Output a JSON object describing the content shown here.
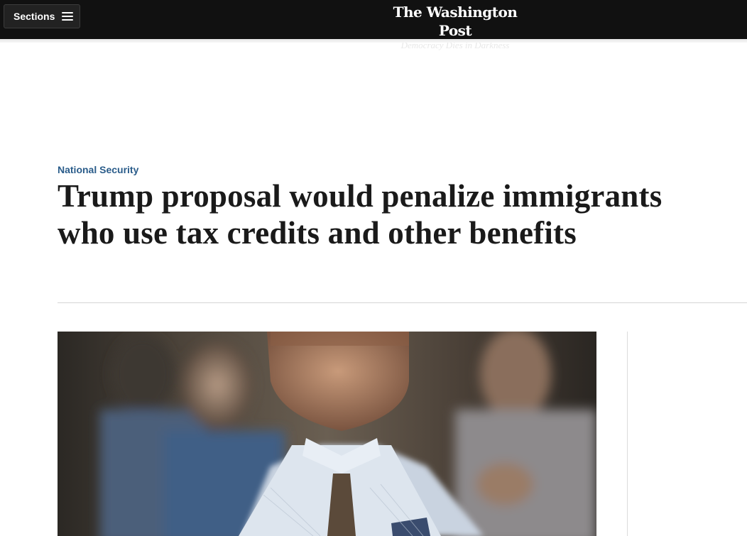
{
  "header": {
    "sections_label": "Sections",
    "menu_icon": "hamburger-menu-icon",
    "logo_text": "The Washington Post",
    "tagline": "Democracy Dies in Darkness"
  },
  "article": {
    "kicker": "National Security",
    "headline": "Trump proposal would penalize immigrants who use tax credits and other benefits",
    "photo_alt": "Man looking upward with hand on chest among a crowd"
  },
  "colors": {
    "topbar": "#111111",
    "kicker": "#2a5c8a",
    "headline": "#1a1a1a"
  }
}
